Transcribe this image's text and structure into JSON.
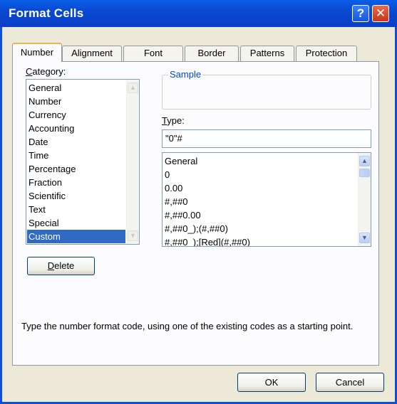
{
  "window": {
    "title": "Format Cells"
  },
  "titlebar": {
    "help_glyph": "?",
    "close_glyph": "✕"
  },
  "tabs": [
    {
      "label": "Number"
    },
    {
      "label": "Alignment"
    },
    {
      "label": "Font"
    },
    {
      "label": "Border"
    },
    {
      "label": "Patterns"
    },
    {
      "label": "Protection"
    }
  ],
  "active_tab": "Number",
  "category": {
    "label": "Category:",
    "items": [
      "General",
      "Number",
      "Currency",
      "Accounting",
      "Date",
      "Time",
      "Percentage",
      "Fraction",
      "Scientific",
      "Text",
      "Special",
      "Custom"
    ],
    "selected": "Custom"
  },
  "sample": {
    "label": "Sample",
    "value": ""
  },
  "type": {
    "label": "Type:",
    "value": "\"0\"#",
    "formats": [
      "General",
      "0",
      "0.00",
      "#,##0",
      "#,##0.00",
      "#,##0_);(#,##0)",
      "#,##0_);[Red](#,##0)"
    ]
  },
  "buttons": {
    "delete": "Delete",
    "ok": "OK",
    "cancel": "Cancel"
  },
  "hint": "Type the number format code, using one of the existing codes as a starting point.",
  "colors": {
    "title_bar": "#0a48d0",
    "selection": "#316ac5",
    "dialog_bg": "#ece9d8",
    "group_title": "#0046d5"
  }
}
